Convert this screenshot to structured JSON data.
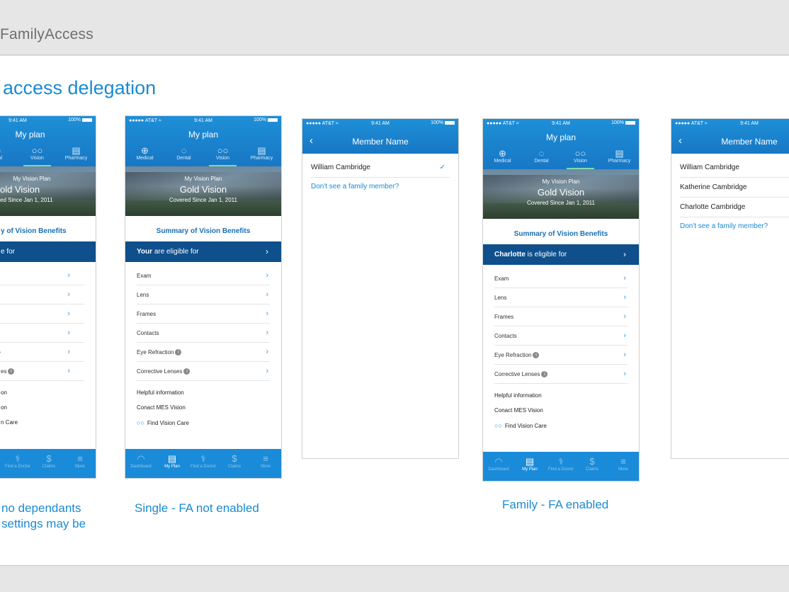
{
  "app_title": "FamilyAccess",
  "page_heading": "access delegation",
  "plan_screen": {
    "status": {
      "carrier": "●●●●● AT&T ≈",
      "time": "9:41 AM",
      "battery": "100%"
    },
    "title": "My plan",
    "tabs": [
      "Medical",
      "Dental",
      "Vision",
      "Pharmacy"
    ],
    "tab_icons": [
      "⊕",
      "◌",
      "○○",
      "▤"
    ],
    "hero": {
      "line1": "My Vision Plan",
      "line2": "Gold Vision",
      "line3": "Covered Since Jan 1, 2011"
    },
    "summary": "Summary of Vision Benefits",
    "rows": [
      "Exam",
      "Lens",
      "Frames",
      "Contacts",
      "Eye Refraction",
      "Corrective Lenses"
    ],
    "help": [
      "Helpful information",
      "Conact MES Vision",
      "Find Vision Care"
    ],
    "tabbar": [
      "Dashboard",
      "My Plan",
      "Find a Doctor",
      "Claims",
      "More"
    ],
    "tabbar_icons": [
      "◠",
      "▤",
      "⚕",
      "$",
      "≡"
    ]
  },
  "screen1": {
    "eligible_rest": "e for",
    "hero_line2": "old Vision",
    "hero_line3": "ed Since Jan 1, 2011",
    "summary": "y of Vision Benefits",
    "title": "My plan",
    "tabs": [
      "ntal",
      "Vision",
      "Pharmacy"
    ],
    "rows_tail": [
      "",
      "",
      "",
      "",
      "",
      "es"
    ],
    "help": [
      "on",
      "on",
      "n Care"
    ]
  },
  "screen2": {
    "eligible_bold": "Your",
    "eligible_rest": " are eligible for"
  },
  "screen3": {
    "title": "Member Name",
    "members": [
      "William Cambridge"
    ],
    "link": "Don't see a family member?",
    "check": "✓"
  },
  "screen4": {
    "eligible_bold": "Charlotte",
    "eligible_rest": " is eligible for"
  },
  "screen5": {
    "title": "Member Name",
    "members": [
      "William Cambridge",
      "Katherine Cambridge",
      "Charlotte Cambridge"
    ],
    "link": "Don't see a family member?"
  },
  "captions": {
    "c1": [
      "no dependants",
      "settings may be",
      ""
    ],
    "c2": "Single - FA not enabled",
    "c4": "Family - FA enabled"
  }
}
